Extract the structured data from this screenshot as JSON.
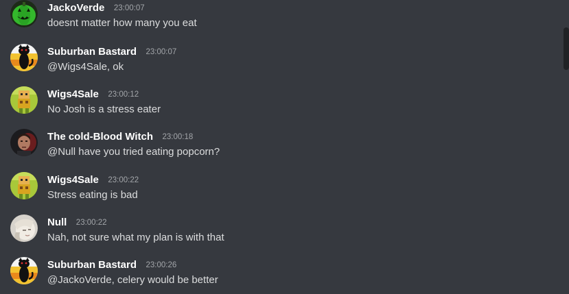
{
  "messages": [
    {
      "author": "JackoVerde",
      "time": "23:00:07",
      "text": "doesnt matter how many you eat",
      "avatar": "pumpkin-avatar-icon"
    },
    {
      "author": "Suburban Bastard",
      "time": "23:00:07",
      "text": "@Wigs4Sale, ok",
      "avatar": "black-cat-avatar-icon"
    },
    {
      "author": "Wigs4Sale",
      "time": "23:00:12",
      "text": "No Josh is a stress eater",
      "avatar": "pixel-character-avatar-icon"
    },
    {
      "author": "The cold-Blood Witch",
      "time": "23:00:18",
      "text": "@Null have you tried eating popcorn?",
      "avatar": "person-portrait-avatar-icon"
    },
    {
      "author": "Wigs4Sale",
      "time": "23:00:22",
      "text": "Stress eating is bad",
      "avatar": "pixel-character-avatar-icon"
    },
    {
      "author": "Null",
      "time": "23:00:22",
      "text": "Nah, not sure what my plan is with that",
      "avatar": "anime-character-avatar-icon"
    },
    {
      "author": "Suburban Bastard",
      "time": "23:00:26",
      "text": "@JackoVerde, celery would be better",
      "avatar": "black-cat-avatar-icon"
    }
  ],
  "colors": {
    "background": "#36393f",
    "username": "#ffffff",
    "message_text": "#dcddde",
    "timestamp": "#a3a6aa",
    "scrollbar": "#202225"
  }
}
